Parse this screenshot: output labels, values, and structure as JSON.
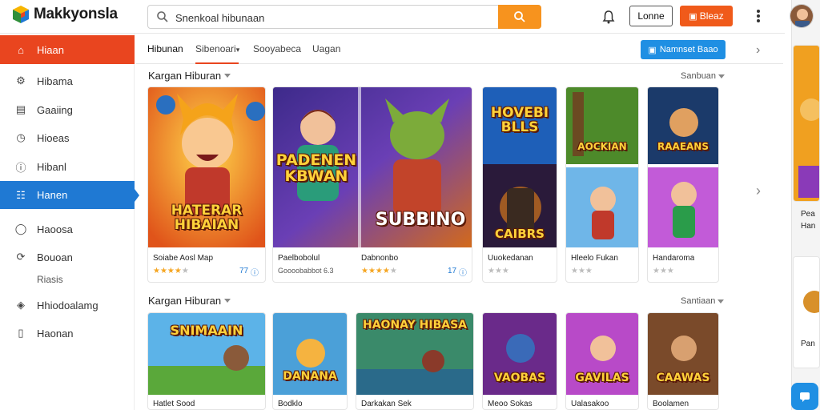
{
  "header": {
    "logo_text": "Makkyonsla",
    "search_value": "Snenkoal hibunaan",
    "login_label": "Lonne",
    "orange_label": "Bleaz"
  },
  "sidebar": {
    "items": [
      {
        "label": "Hiaan",
        "icon": "home-icon"
      },
      {
        "label": "Hibama",
        "icon": "gear-icon"
      },
      {
        "label": "Gaaiing",
        "icon": "chart-icon"
      },
      {
        "label": "Hioeas",
        "icon": "clock-icon"
      },
      {
        "label": "Hibanl",
        "icon": "info-icon"
      },
      {
        "label": "Hanen",
        "icon": "gamepad-icon"
      },
      {
        "label": "Haoosa",
        "icon": "compass-icon"
      },
      {
        "label": "Bouoan",
        "icon": "refresh-icon"
      },
      {
        "label": "Riasis",
        "icon": ""
      },
      {
        "label": "Hhiodoalamg",
        "icon": "shield-icon"
      },
      {
        "label": "Haonan",
        "icon": "phone-icon"
      }
    ]
  },
  "tabs": {
    "items": [
      "Hibunan",
      "Sibenoari",
      "Sooyabeca",
      "Uagan"
    ],
    "cta_label": "Namnset Baao"
  },
  "section1": {
    "title": "Kargan Hiburan",
    "more": "Sanbuan",
    "cards": [
      {
        "art_title": "HATERAR HIBAIAN",
        "name": "Soiabe Aosl Map",
        "stars": 4,
        "extra": ""
      },
      {
        "art_title": "PADENEN KBWAN",
        "name": "Paelbobolul",
        "stars": 0,
        "extra": "Goooobabbot 6.3"
      },
      {
        "art_title": "SUBBINO",
        "name": "Dabnonbo",
        "stars": 4,
        "extra": ""
      },
      {
        "art_title": "HOVEBI BLLS",
        "name": "Uuokedanan",
        "stars": 2,
        "extra": ""
      },
      {
        "art_title": "AOCKIAN",
        "name": "Hleelo Fukan",
        "stars": 0,
        "extra": ""
      },
      {
        "art_title": "RAAEANS",
        "name": "Handaroma",
        "stars": 0,
        "extra": ""
      }
    ],
    "card1_badge": "77",
    "card3_badge": "17"
  },
  "section2": {
    "title": "Kargan Hiburan",
    "more": "Santiaan",
    "cards": [
      {
        "art_title": "SNIMAAIN",
        "name": "Hatlet Sood"
      },
      {
        "art_title": "DANANA",
        "name": "Bodklo"
      },
      {
        "art_title": "HAONAY HIBASA",
        "name": "Darkakan Sek"
      },
      {
        "art_title": "VAOBAS",
        "name": "Meoo Sokas"
      },
      {
        "art_title": "GAVILAS",
        "name": "Ualasakoo"
      },
      {
        "art_title": "CAAWAS",
        "name": "Boolamen"
      }
    ]
  },
  "right_panel": {
    "text1": "Pea",
    "text2": "Han",
    "text3": "Pan"
  },
  "colors": {
    "accent_orange": "#f7931e",
    "accent_red": "#e9451f",
    "accent_blue": "#1f79d3",
    "star": "#f5a623"
  }
}
